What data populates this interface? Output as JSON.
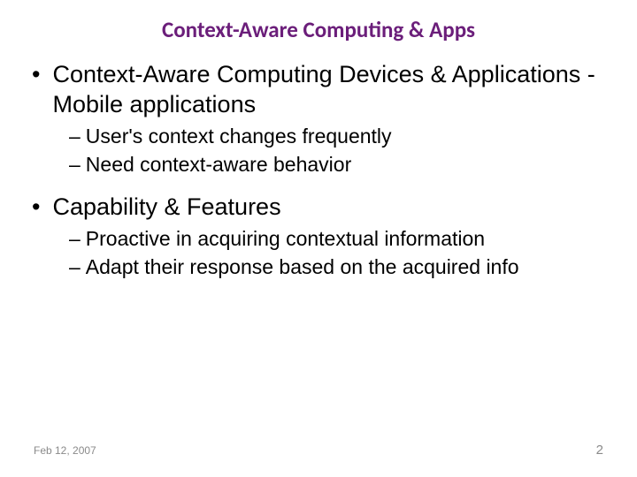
{
  "title": "Context-Aware Computing & Apps",
  "bullets": {
    "b1": "Context-Aware Computing Devices & Applications - Mobile applications",
    "b1s1": "User's context changes frequently",
    "b1s2": "Need context-aware behavior",
    "b2": "Capability & Features",
    "b2s1": "Proactive in acquiring contextual information",
    "b2s2": "Adapt their response based on the acquired info"
  },
  "footer": {
    "date": "Feb 12, 2007",
    "page": "2"
  }
}
